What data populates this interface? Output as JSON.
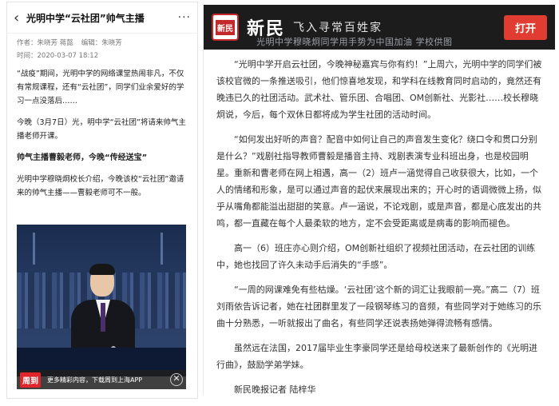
{
  "left": {
    "header": {
      "back": "‹",
      "title": "光明中学“云社团”帅气主播",
      "more": "···"
    },
    "meta": {
      "author_label": "作者：",
      "author": "朱晓芳 蒋懿",
      "editor_label": "编辑：",
      "editor": "朱晓芳",
      "time_label": "时间：",
      "time": "2020-03-07 18:12"
    },
    "paragraphs": [
      "“战疫”期间，光明中学的网络课堂热闹非凡，不仅有常规课程，还有“云社团”，同学们业余爱好的学习一点没落后……",
      "今晚（3月7日）光，明中学“云社团”将请来帅气主播老师开课。"
    ],
    "subheading": "帅气主播曹毅老师，今晚“传经送宝”",
    "paragraph_after": "光明中学穆晓炯校长介绍，今晚该校“云社团”邀请来的帅气主播——曹毅老师可不一般。",
    "bottom_bar": {
      "logo": "周到",
      "text": "更多精彩内容，下载周到上海APP",
      "close": "✕"
    }
  },
  "right": {
    "banner": {
      "seal": "新民",
      "brand": "新民",
      "slogan": "飞入寻常百姓家",
      "open_button": "打开",
      "overlay_caption": "光明中学穆晓炯同学用手势为中国加油 学校供图"
    },
    "paragraphs": [
      "“光明中学开启云社团，今晚神秘嘉宾与你有约！”上周六，光明中学的同学们被该校官微的一条推送吸引，他们惊喜地发现，和学科在线教育同时启动的，竟然还有晚违已久的社团活动。武术社、管乐团、合唱团、OM创新社、光影社……校长穆晓炯说，今后，每个双休日都将成为学生社团的活动时间。",
      "“如何发出好听的声音？配音中如何让自己的声音发生变化？绕口令和贯口分别是什么？”戏剧社指导教师曹毅是播音主持、戏剧表演专业科班出身，也是校园明星。重新和曹老师在网上相遇，高一（2）班卢一涵觉得自己收获很大，比如，一个人的情绪和形象，是可以通过声音的起伏来展现出来的；开心时的语调微微上扬，似乎从嘴角都能溢出甜甜的笑意。卢一涵说，不论戏剧，或是声音，都是心底发出的共鸣，都一直藏在每个人最柔软的地方，定不会受距离或是病毒的影响而褪色。",
      "高一（6）班庄亦心则介绍，OM创新社组织了视频社团活动，在云社团的训练中，她也找回了许久未动手后消失的“手感”。",
      "“一周的网课难免有些枯燥。‘云社团’这个新的词汇让我眼前一亮。”高二（7）班刘雨依告诉记者，她在社团群里发了一段钢琴练习的音频，有些同学对于她练习的乐曲十分熟悉，一听就报出了曲名，有些同学还说表扬她弹得流畅有感情。",
      "虽然远在法国，2017届毕业生李豪同学还是给母校送来了最新创作的《光明进行曲》，鼓励学弟学妹。"
    ],
    "signature": "新民晚报记者  陆梓华"
  },
  "colors": {
    "accent_red": "#e03c31",
    "banner_bg": "#1c1c1c"
  }
}
